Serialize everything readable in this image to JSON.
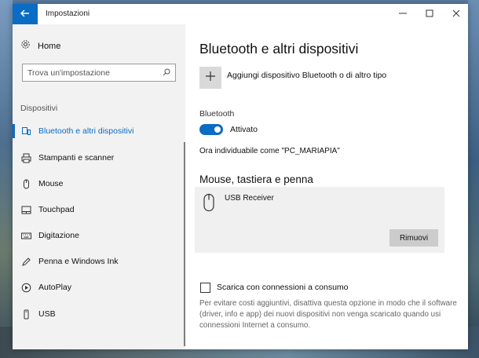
{
  "window": {
    "title": "Impostazioni",
    "back_icon": "arrow-left-icon",
    "controls": [
      "minimize-icon",
      "maximize-icon",
      "close-icon"
    ]
  },
  "sidebar": {
    "home_label": "Home",
    "search_placeholder": "Trova un'impostazione",
    "section_title": "Dispositivi",
    "items": [
      {
        "label": "Bluetooth e altri dispositivi",
        "icon": "devices-icon",
        "active": true
      },
      {
        "label": "Stampanti e scanner",
        "icon": "printer-icon",
        "active": false
      },
      {
        "label": "Mouse",
        "icon": "mouse-icon",
        "active": false
      },
      {
        "label": "Touchpad",
        "icon": "touchpad-icon",
        "active": false
      },
      {
        "label": "Digitazione",
        "icon": "keyboard-icon",
        "active": false
      },
      {
        "label": "Penna e Windows Ink",
        "icon": "pen-icon",
        "active": false
      },
      {
        "label": "AutoPlay",
        "icon": "autoplay-icon",
        "active": false
      },
      {
        "label": "USB",
        "icon": "usb-icon",
        "active": false
      }
    ]
  },
  "main": {
    "title": "Bluetooth e altri dispositivi",
    "add_device_label": "Aggiungi dispositivo Bluetooth o di altro tipo",
    "bluetooth_label": "Bluetooth",
    "bluetooth_state": "Attivato",
    "bluetooth_on": true,
    "discoverable_text": "Ora individuabile come \"PC_MARIAPIA\"",
    "section_heading": "Mouse, tastiera e penna",
    "device_name": "USB Receiver",
    "remove_label": "Rimuovi",
    "metered_label": "Scarica con connessioni a consumo",
    "metered_checked": false,
    "metered_description": "Per evitare costi aggiuntivi, disattiva questa opzione in modo che il software (driver, info e app) dei nuovi dispositivi non venga scaricato quando usi connessioni Internet a consumo."
  },
  "colors": {
    "accent": "#0a6cc4",
    "sidebar_bg": "#f2f2f2",
    "card_bg": "#f0f0f0"
  }
}
